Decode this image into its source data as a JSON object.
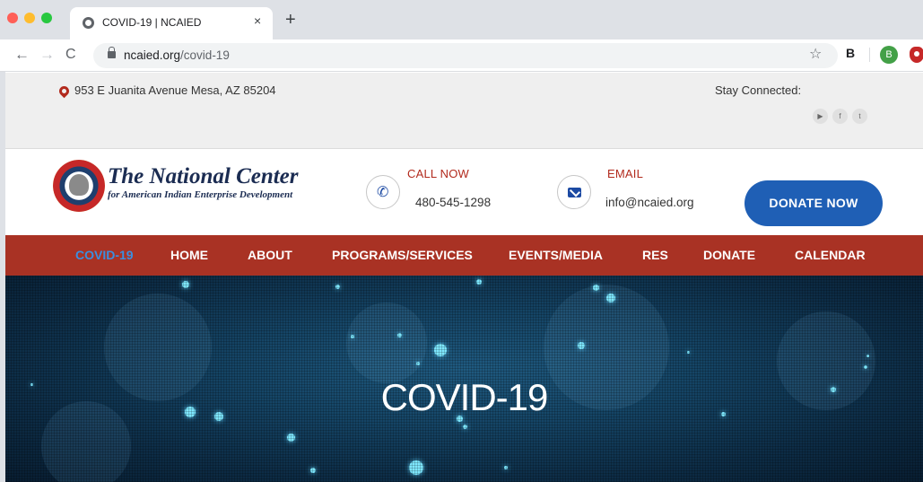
{
  "browser": {
    "tab_title": "COVID-19 | NCAIED",
    "tab_close": "×",
    "new_tab": "+",
    "back": "←",
    "forward": "→",
    "reload": "C",
    "url_domain": "ncaied.org",
    "url_path": "/covid-19",
    "star": "☆",
    "extension": "B",
    "profile_initial": "B"
  },
  "topbar": {
    "address": "953 E Juanita Avenue Mesa, AZ 85204",
    "stay_connected": "Stay Connected:",
    "social": {
      "youtube": "▶",
      "facebook": "f",
      "twitter": "t"
    }
  },
  "header": {
    "logo_title": "The National Center",
    "logo_subtitle": "for American Indian Enterprise Development",
    "call_label": "CALL NOW",
    "call_value": "480-545-1298",
    "email_label": "EMAIL",
    "email_value": "info@ncaied.org",
    "donate_label": "DONATE NOW"
  },
  "nav": {
    "items": [
      "COVID-19",
      "HOME",
      "ABOUT",
      "PROGRAMS/SERVICES",
      "EVENTS/MEDIA",
      "RES",
      "DONATE",
      "CALENDAR"
    ]
  },
  "hero": {
    "title": "COVID-19"
  },
  "colors": {
    "brand_red": "#a93224",
    "brand_blue": "#1f5fb5",
    "nav_active": "#3a8fe0",
    "logo_navy": "#1b2c52"
  }
}
